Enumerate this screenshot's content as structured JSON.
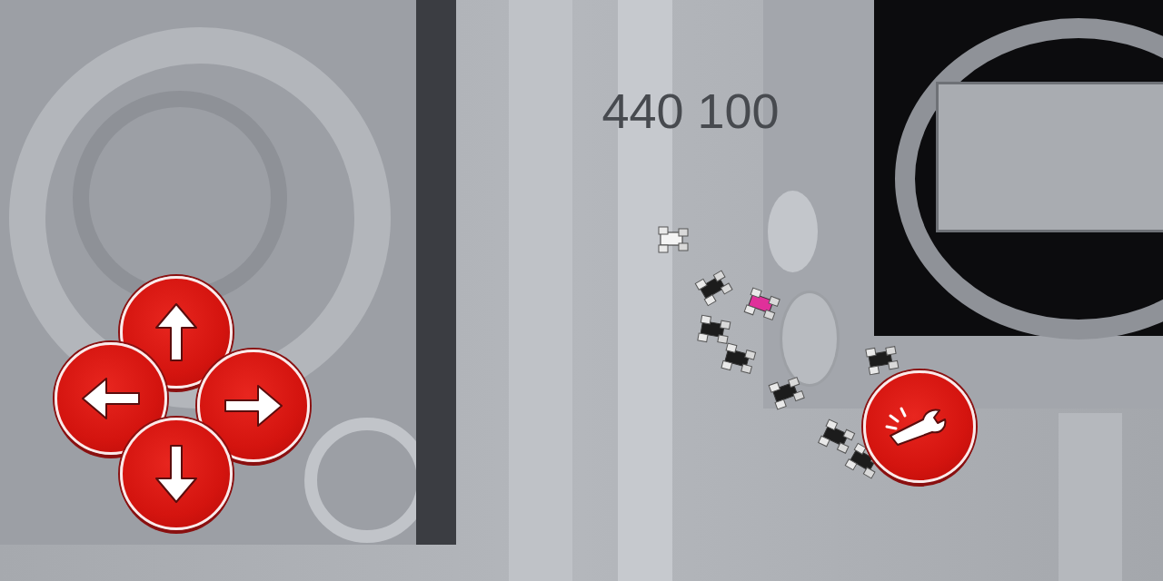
{
  "score": "440 100",
  "dpad": [
    {
      "kind": "up"
    },
    {
      "kind": "left"
    },
    {
      "kind": "right"
    },
    {
      "kind": "down"
    }
  ],
  "player": {
    "color": "#f4f4f4"
  },
  "units": [
    {
      "color": "#1c1c1c"
    },
    {
      "color": "#e0309a"
    },
    {
      "color": "#1c1c1c"
    },
    {
      "color": "#1c1c1c"
    },
    {
      "color": "#1c1c1c"
    },
    {
      "color": "#1c1c1c"
    },
    {
      "color": "#1c1c1c"
    },
    {
      "color": "#1c1c1c"
    }
  ]
}
